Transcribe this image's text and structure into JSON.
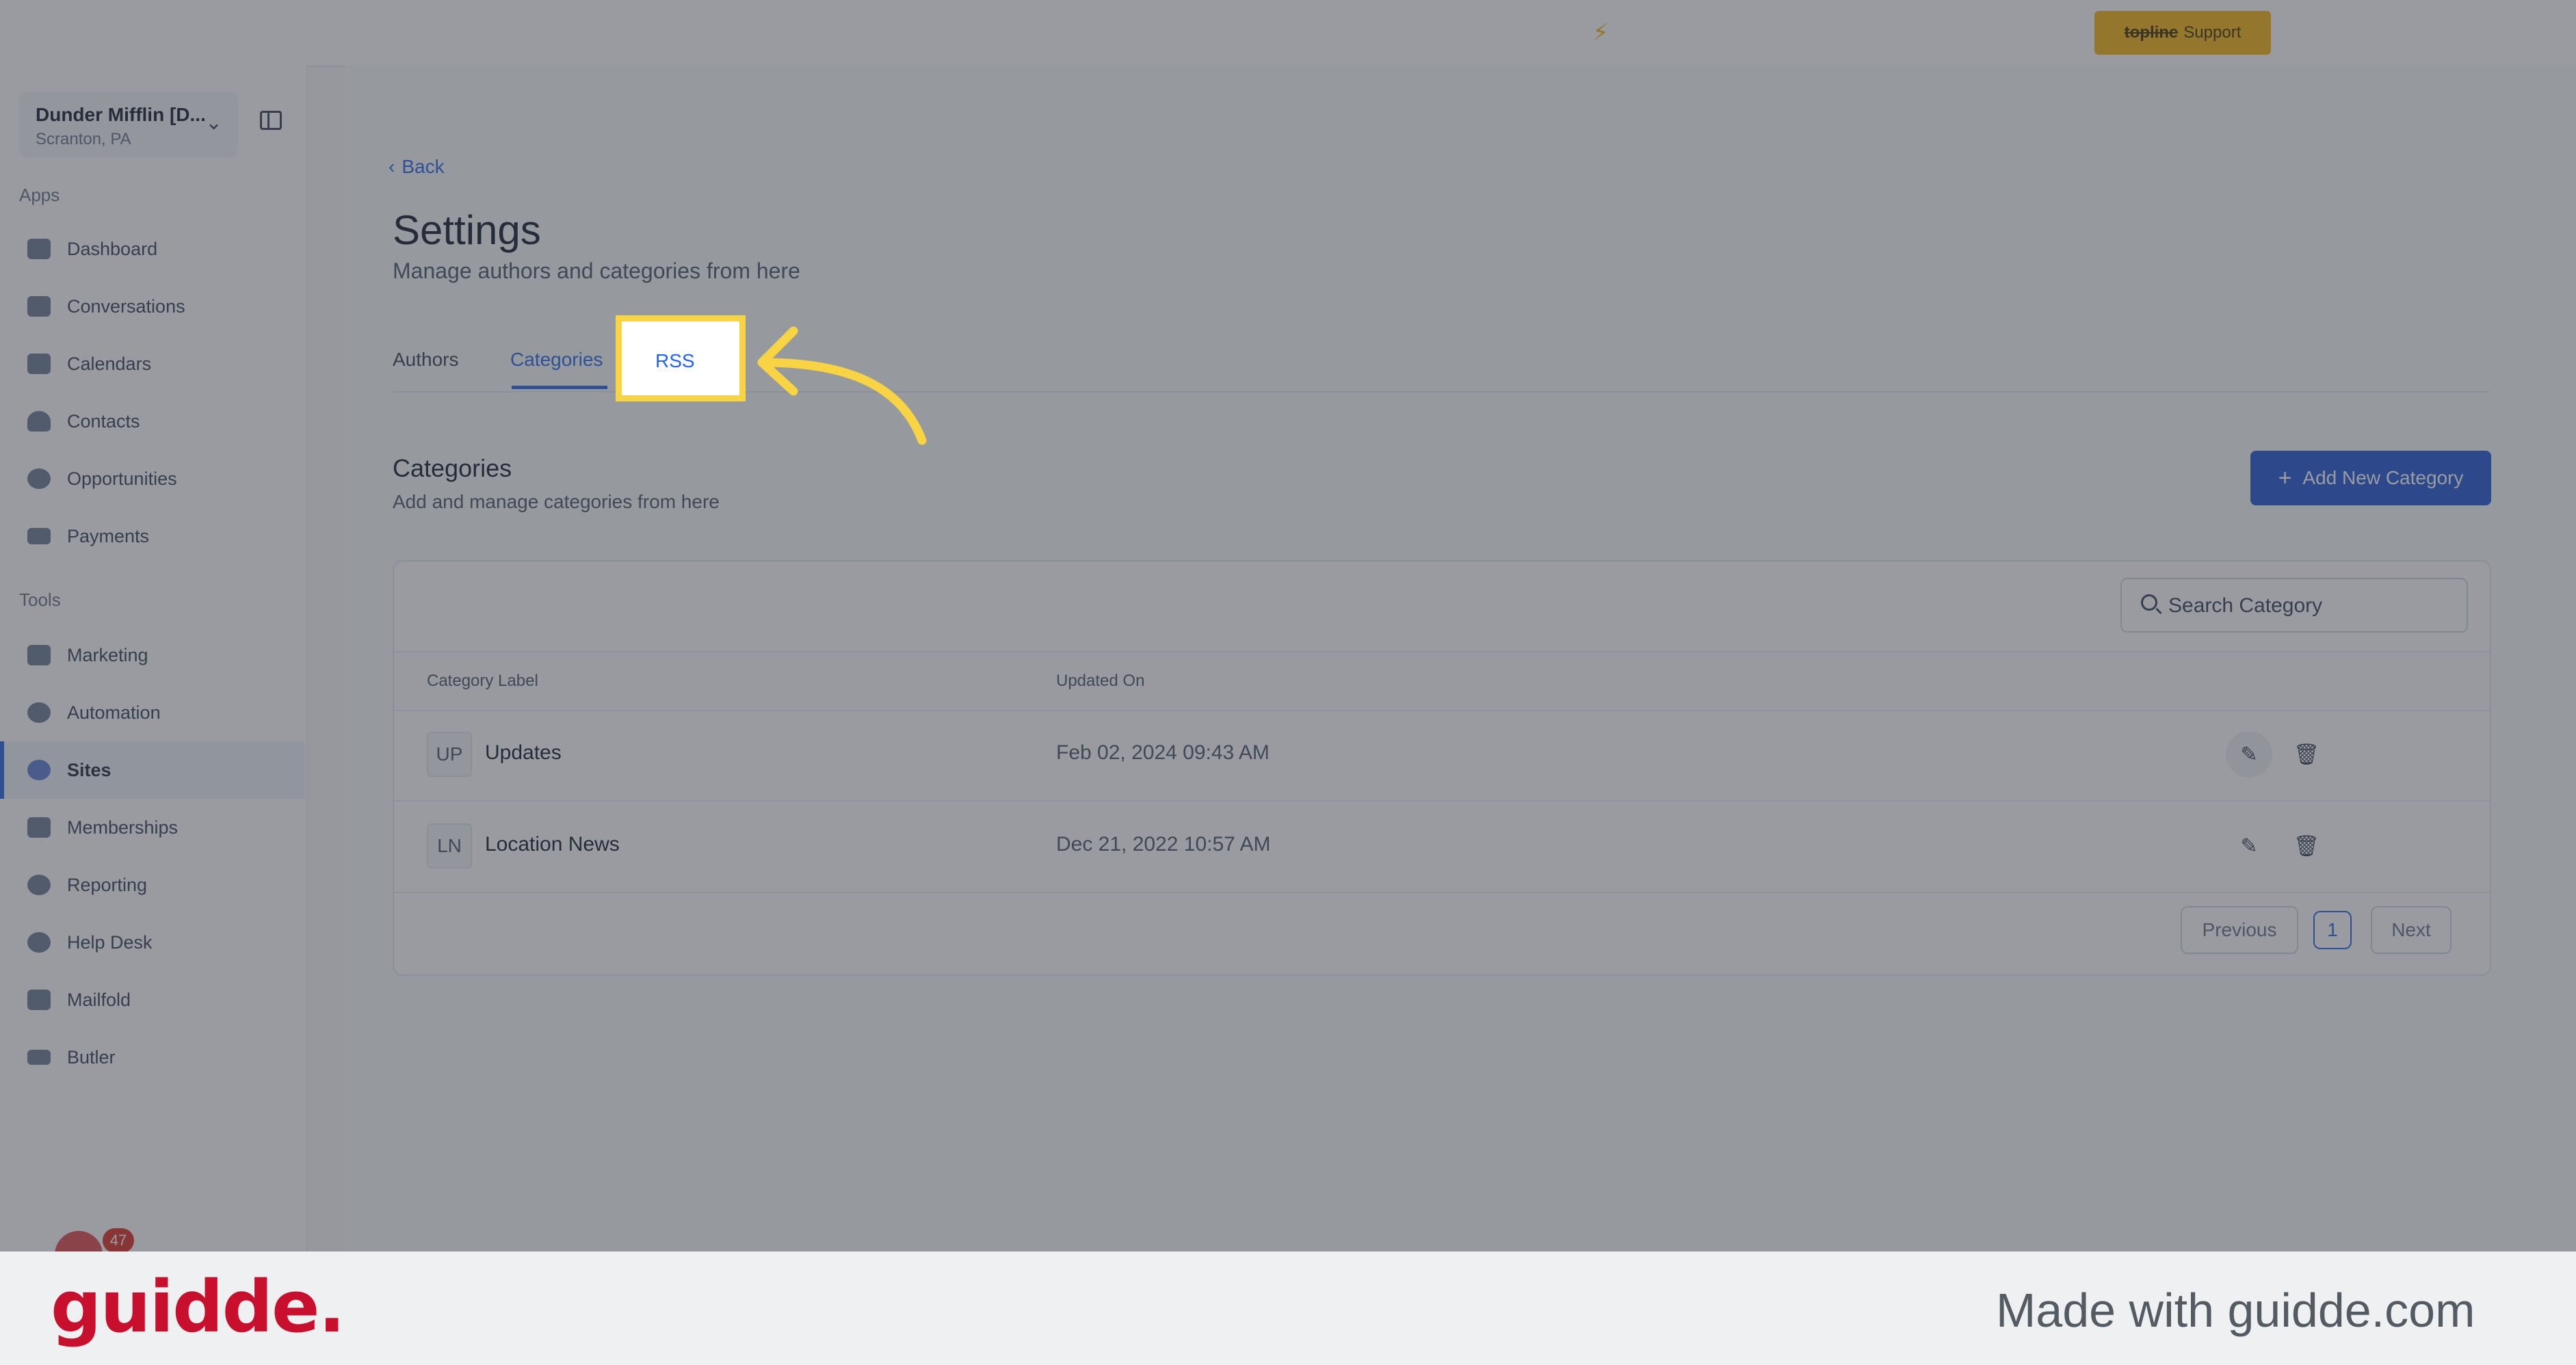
{
  "topbar": {
    "support_brand": "topline",
    "support_label": "Support",
    "faint_left": "",
    "faint_right": ""
  },
  "sidebar": {
    "location": {
      "name": "Dunder Mifflin [D...",
      "sub": "Scranton, PA"
    },
    "apps_label": "Apps",
    "tools_label": "Tools",
    "apps": [
      {
        "label": "Dashboard",
        "icon": "dashboard-icon"
      },
      {
        "label": "Conversations",
        "icon": "chat-icon"
      },
      {
        "label": "Calendars",
        "icon": "calendar-icon"
      },
      {
        "label": "Contacts",
        "icon": "person-icon"
      },
      {
        "label": "Opportunities",
        "icon": "target-icon"
      },
      {
        "label": "Payments",
        "icon": "credit-card-icon"
      }
    ],
    "tools": [
      {
        "label": "Marketing",
        "icon": "megaphone-icon"
      },
      {
        "label": "Automation",
        "icon": "gears-icon"
      },
      {
        "label": "Sites",
        "icon": "globe-icon",
        "active": true
      },
      {
        "label": "Memberships",
        "icon": "group-icon"
      },
      {
        "label": "Reporting",
        "icon": "pie-chart-icon"
      },
      {
        "label": "Help Desk",
        "icon": "help-icon"
      },
      {
        "label": "Mailfold",
        "icon": "mail-icon"
      },
      {
        "label": "Butler",
        "icon": "butler-icon"
      }
    ],
    "notification_count": "47"
  },
  "page": {
    "back_label": "Back",
    "title": "Settings",
    "subtitle": "Manage authors and categories from here",
    "tabs": [
      {
        "label": "Authors"
      },
      {
        "label": "Categories",
        "active": true
      },
      {
        "label": "RSS"
      }
    ]
  },
  "categories": {
    "title": "Categories",
    "subtitle": "Add and manage categories from here",
    "add_button": "Add New Category",
    "search_placeholder": "Search Category",
    "columns": [
      "Category Label",
      "Updated On"
    ],
    "rows": [
      {
        "initials": "UP",
        "label": "Updates",
        "updated": "Feb 02, 2024 09:43 AM"
      },
      {
        "initials": "LN",
        "label": "Location News",
        "updated": "Dec 21, 2022 10:57 AM"
      }
    ],
    "pagination": {
      "previous": "Previous",
      "current": "1",
      "next": "Next"
    }
  },
  "footer": {
    "logo": "guidde.",
    "made_with": "Made with guidde.com"
  },
  "colors": {
    "accent": "#2563eb",
    "highlight": "#f8d343",
    "support_button": "#f5b40f",
    "guidde_red": "#c8102e"
  }
}
